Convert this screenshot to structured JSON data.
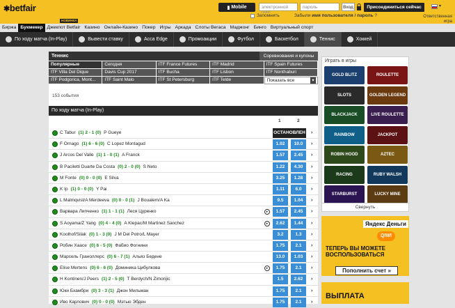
{
  "header": {
    "logo": "betfair",
    "mobile_label": "Mobile",
    "email_placeholder": "электронной почт",
    "password_placeholder": "пароль",
    "login_label": "Вход",
    "join_label": "Присоединиться сейчас",
    "remember_label": "Запомнить",
    "forgot_prefix": "Забыли",
    "forgot_bold": "имя пользователя / пароль",
    "forgot_suffix": "?",
    "responsible": "Ответственная игра",
    "new_badge": "НОВИНКА"
  },
  "mainnav": [
    "Биржа",
    "Букмекер",
    "Джекпот Betfair",
    "Казино",
    "Онлайн-Казино",
    "Покер",
    "Игры",
    "Аркада",
    "Слоты Вегаса",
    "Маджонг",
    "Бинго",
    "Виртуальный спорт"
  ],
  "subnav": [
    "По ходу матча (In-Play)",
    "Вывести ставку",
    "Acca Edge",
    "Промоакции",
    "Футбол",
    "Баскетбол",
    "Теннис",
    "Хоккей"
  ],
  "tennis": {
    "title": "Теннис",
    "coupons": "Соревнования и купоны",
    "grid": [
      [
        "Популярные",
        "Сегодня",
        "ITF France Futures",
        "ITF Madrid",
        "ITF Spain Futures"
      ],
      [
        "ITF Villa Del Dique",
        "Davis Cup 2017",
        "ITF Bucha",
        "ITF Lisbon",
        "ITF Nonthaburi"
      ],
      [
        "ITF Podgorica, Mont...",
        "ITF Saint Malo",
        "ITF St Petersburg",
        "ITF Telde",
        "Показать все"
      ]
    ],
    "events_count": "153 события",
    "inplay_title": "По ходу матча (In-Play)",
    "col1": "1",
    "col2": "2",
    "suspended": "ОСТАНОВЛЕН",
    "rows": [
      {
        "home": "C Tabur",
        "score": "(1) 2 - 1 (0)",
        "away": "P Gueye",
        "o1": "",
        "o2": "",
        "susp": true,
        "tv": false
      },
      {
        "home": "F Ornago",
        "score": "(1) 6 - 6 (0)",
        "away": "C Lopez Montagud",
        "o1": "1.02",
        "o2": "10.0",
        "susp": false,
        "tv": false
      },
      {
        "home": "J Arcos Del Valle",
        "score": "(1) 1 - 0 (1)",
        "away": "A Franck",
        "o1": "1.57",
        "o2": "2.45",
        "susp": false,
        "tv": false
      },
      {
        "home": "B Paciletti Duarte Da Costa",
        "score": "(0) 2 - 0 (0)",
        "away": "S Neto",
        "o1": "1.22",
        "o2": "4.30",
        "susp": false,
        "tv": false
      },
      {
        "home": "M Fonte",
        "score": "(0) 0 - 0 (0)",
        "away": "E Silva",
        "o1": "3.25",
        "o2": "1.28",
        "susp": false,
        "tv": false
      },
      {
        "home": "K Ip",
        "score": "(1) 0 - 0 (0)",
        "away": "Y Pai",
        "o1": "1.11",
        "o2": "6.0",
        "susp": false,
        "tv": false
      },
      {
        "home": "L Malmqvist/A Merdeeva",
        "score": "(0) 0 - 0 (1)",
        "away": "J Boualem/A Ka",
        "o1": "9.5",
        "o2": "1.04",
        "susp": false,
        "tv": false
      },
      {
        "home": "Варвара Липченко",
        "score": "(1) 1 - 1 (1)",
        "away": "Леся Цуренко",
        "o1": "1.57",
        "o2": "2.45",
        "susp": false,
        "tv": true
      },
      {
        "home": "S Aoyama/Z Yang",
        "score": "(0) 4 - 4 (0)",
        "away": "A Klepac/M Martinez Sanchez",
        "o1": "2.62",
        "o2": "1.44",
        "susp": false,
        "tv": true
      },
      {
        "home": "Koolhof/Silak",
        "score": "(0) 1 - 3 (0)",
        "away": "J M Del Potro/L Mayer",
        "o1": "3.2",
        "o2": "1.3",
        "susp": false,
        "tv": false
      },
      {
        "home": "Робин Хаасе",
        "score": "(0) 6 - 5 (0)",
        "away": "Фабио Фогнини",
        "o1": "1.75",
        "o2": "2.1",
        "susp": false,
        "tv": false
      },
      {
        "home": "Марсель Граноллерс",
        "score": "(0) 6 - 7 (1)",
        "away": "Альяз Бедене",
        "o1": "13.0",
        "o2": "1.03",
        "susp": false,
        "tv": false
      },
      {
        "home": "Elise Mertens",
        "score": "(0) 6 - 6 (0)",
        "away": "Доминика Цибулкова",
        "o1": "1.75",
        "o2": "2.1",
        "susp": false,
        "tv": true
      },
      {
        "home": "H Kontinen/J Peers",
        "score": "(1) 2 - 5 (0)",
        "away": "T Berdych/N Zimonjic",
        "o1": "1.5",
        "o2": "2.62",
        "susp": false,
        "tv": false
      },
      {
        "home": "Юки Бхамбри",
        "score": "(0) 3 - 3 (1)",
        "away": "Джон Мильман",
        "o1": "1.75",
        "o2": "2.1",
        "susp": false,
        "tv": false
      },
      {
        "home": "Иво Карлович",
        "score": "(0) 0 - 0 (0)",
        "away": "Мэтью Эбден",
        "o1": "1.75",
        "o2": "2.1",
        "susp": false,
        "tv": false
      }
    ]
  },
  "games": {
    "title": "Играть в игры",
    "collapse": "Свернуть",
    "tiles": [
      {
        "label": "GOLD BLITZ",
        "color": "#1b3f6e"
      },
      {
        "label": "ROULETTE",
        "color": "#7a1515"
      },
      {
        "label": "SLOTS",
        "color": "#2a2a2a"
      },
      {
        "label": "GOLDEN LEGEND",
        "color": "#6b3a0f"
      },
      {
        "label": "BLACKJACK",
        "color": "#184d25"
      },
      {
        "label": "LIVE ROULETTE",
        "color": "#3a1e4f"
      },
      {
        "label": "RAINBOW",
        "color": "#0f5f88"
      },
      {
        "label": "JACKPOT",
        "color": "#5c1212"
      },
      {
        "label": "ROBIN HOOD",
        "color": "#2f4a1a"
      },
      {
        "label": "AZTEC",
        "color": "#7a5a12"
      },
      {
        "label": "RACING",
        "color": "#1a3a1a"
      },
      {
        "label": "RUBY WALSH",
        "color": "#12395c"
      },
      {
        "label": "STARBURST",
        "color": "#2b1452"
      },
      {
        "label": "LUCKY MINE",
        "color": "#5c3a12"
      }
    ]
  },
  "ads": {
    "yandex": "Яндекс Деньги",
    "qiwi": "QIWI",
    "text": "ТЕПЕРЬ ВЫ МОЖЕТЕ ВОСПОЛЬЗОВАТЬСЯ",
    "button": "Пополнить счет »",
    "ad2": "ВЫПЛАТА"
  },
  "colors": {
    "brand": "#f5c122",
    "odds": "#3a8ed6",
    "live": "#1f8b1f"
  }
}
